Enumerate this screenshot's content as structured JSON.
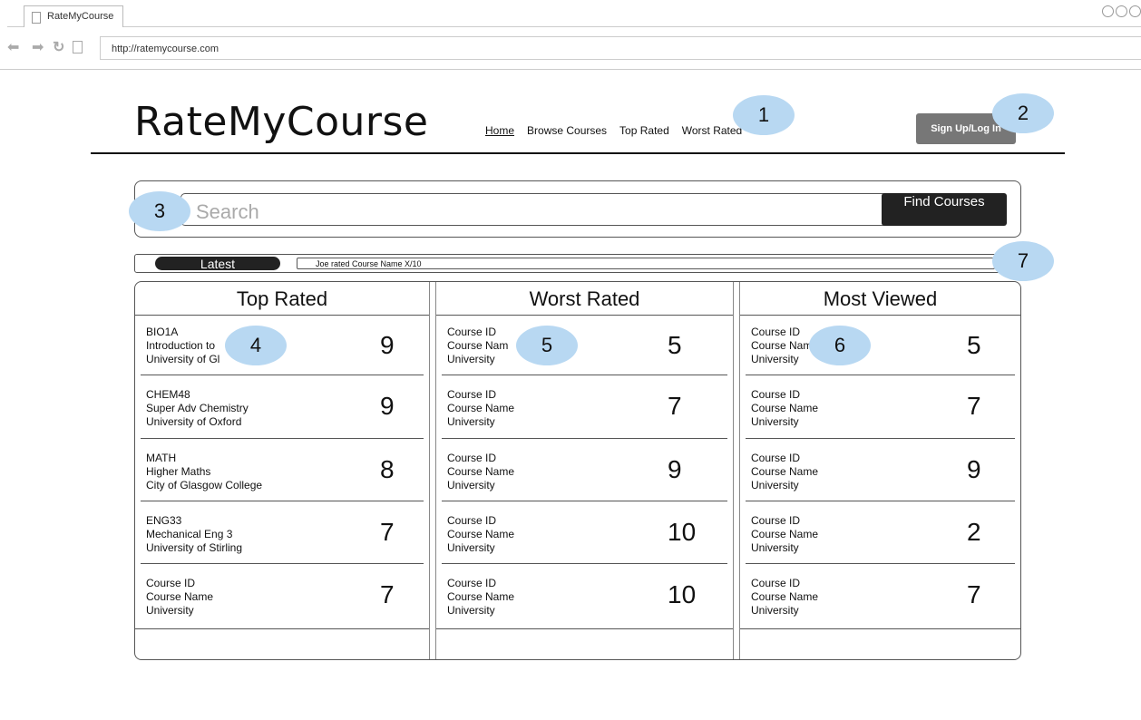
{
  "browser": {
    "tab_title": "RateMyCourse",
    "url": "http://ratemycourse.com"
  },
  "header": {
    "logo": "RateMyCourse",
    "nav": [
      "Home",
      "Browse Courses",
      "Top Rated",
      "Worst Rated"
    ],
    "signup_label": "Sign Up/Log In"
  },
  "search": {
    "placeholder": "Search",
    "button_label": "Find Courses"
  },
  "latest": {
    "label": "Latest",
    "text": "Joe rated Course Name X/10"
  },
  "columns": [
    {
      "title": "Top Rated",
      "rows": [
        {
          "lines": [
            "BIO1A",
            "Introduction to",
            "University of Gl"
          ],
          "score": "9"
        },
        {
          "lines": [
            "CHEM48",
            "Super Adv Chemistry",
            "University of Oxford"
          ],
          "score": "9"
        },
        {
          "lines": [
            "MATH",
            "Higher Maths",
            "City of Glasgow College"
          ],
          "score": "8"
        },
        {
          "lines": [
            "ENG33",
            "Mechanical Eng 3",
            "University of Stirling"
          ],
          "score": "7"
        },
        {
          "lines": [
            "Course ID",
            "Course Name",
            "University"
          ],
          "score": "7"
        }
      ]
    },
    {
      "title": "Worst Rated",
      "rows": [
        {
          "lines": [
            "Course ID",
            "Course Nam",
            "University"
          ],
          "score": "5"
        },
        {
          "lines": [
            "Course ID",
            "Course Name",
            "University"
          ],
          "score": "7"
        },
        {
          "lines": [
            "Course ID",
            "Course Name",
            "University"
          ],
          "score": "9"
        },
        {
          "lines": [
            "Course ID",
            "Course Name",
            "University"
          ],
          "score": "10"
        },
        {
          "lines": [
            "Course ID",
            "Course Name",
            "University"
          ],
          "score": "10"
        }
      ]
    },
    {
      "title": "Most Viewed",
      "rows": [
        {
          "lines": [
            "Course ID",
            "Course Nam",
            "University"
          ],
          "score": "5"
        },
        {
          "lines": [
            "Course ID",
            "Course Name",
            "University"
          ],
          "score": "7"
        },
        {
          "lines": [
            "Course ID",
            "Course Name",
            "University"
          ],
          "score": "9"
        },
        {
          "lines": [
            "Course ID",
            "Course Name",
            "University"
          ],
          "score": "2"
        },
        {
          "lines": [
            "Course ID",
            "Course Name",
            "University"
          ],
          "score": "7"
        }
      ]
    }
  ],
  "callouts": [
    "1",
    "2",
    "3",
    "4",
    "5",
    "6",
    "7"
  ]
}
